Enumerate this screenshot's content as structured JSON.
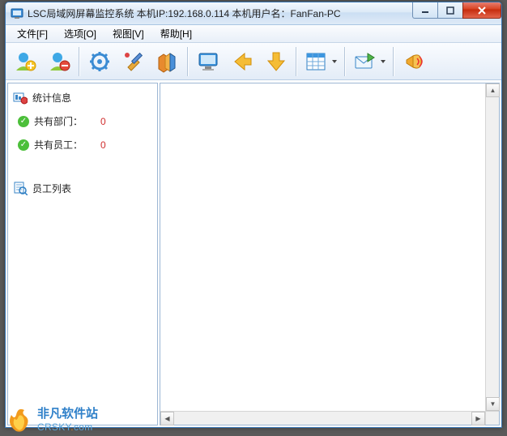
{
  "titlebar": {
    "text": "LSC局域网屏幕监控系统   本机IP:192.168.0.114   本机用户名：FanFan-PC"
  },
  "menu": {
    "file": "文件[F]",
    "options": "选项[O]",
    "view": "视图[V]",
    "help": "帮助[H]"
  },
  "sidebar": {
    "stats_heading": "统计信息",
    "dept_label": "共有部门：",
    "dept_value": "0",
    "emp_label": "共有员工：",
    "emp_value": "0",
    "list_heading": "员工列表"
  },
  "watermark": {
    "cn": "非凡软件站",
    "en_pre": "CRSKY",
    "en_dot": ".",
    "en_post": "com"
  }
}
